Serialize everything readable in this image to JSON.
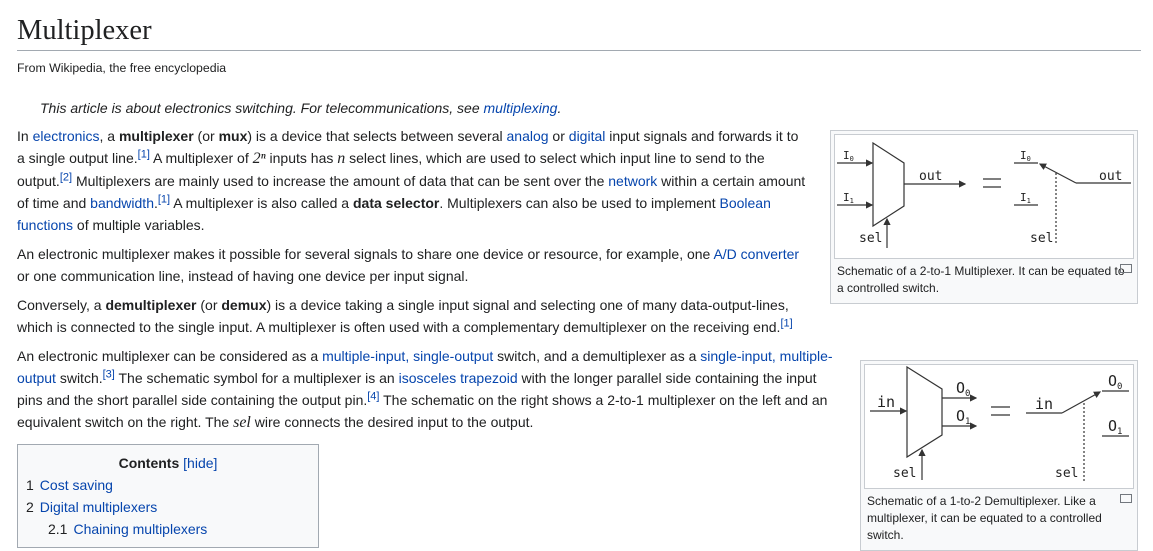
{
  "title": "Multiplexer",
  "tagline": "From Wikipedia, the free encyclopedia",
  "hatnote": {
    "text": "This article is about electronics switching. For telecommunications, see ",
    "link": "multiplexing",
    "end": "."
  },
  "paragraphs": [
    [
      [
        "t",
        "In "
      ],
      [
        "a",
        "electronics"
      ],
      [
        "t",
        ", a "
      ],
      [
        "b",
        "multiplexer"
      ],
      [
        "t",
        " (or "
      ],
      [
        "b",
        "mux"
      ],
      [
        "t",
        ") is a device that selects between several "
      ],
      [
        "a",
        "analog"
      ],
      [
        "t",
        " or "
      ],
      [
        "a",
        "digital"
      ],
      [
        "t",
        " input signals and forwards it to a single output line."
      ],
      [
        "sup",
        "[1]"
      ],
      [
        "t",
        " A multiplexer of "
      ],
      [
        "m",
        "2ⁿ"
      ],
      [
        "t",
        " inputs has "
      ],
      [
        "m",
        "n"
      ],
      [
        "t",
        " select lines, which are used to select which input line to send to the output."
      ],
      [
        "sup",
        "[2]"
      ],
      [
        "t",
        " Multiplexers are mainly used to increase the amount of data that can be sent over the "
      ],
      [
        "a",
        "network"
      ],
      [
        "t",
        " within a certain amount of time and "
      ],
      [
        "a",
        "bandwidth"
      ],
      [
        "t",
        "."
      ],
      [
        "sup",
        "[1]"
      ],
      [
        "t",
        " A multiplexer is also called a "
      ],
      [
        "b",
        "data selector"
      ],
      [
        "t",
        ". Multiplexers can also be used to implement "
      ],
      [
        "a",
        "Boolean functions"
      ],
      [
        "t",
        " of multiple variables."
      ]
    ],
    [
      [
        "t",
        "An electronic multiplexer makes it possible for several signals to share one device or resource, for example, one "
      ],
      [
        "a",
        "A/D converter"
      ],
      [
        "t",
        " or one communication line, instead of having one device per input signal."
      ]
    ],
    [
      [
        "t",
        "Conversely, a "
      ],
      [
        "b",
        "demultiplexer"
      ],
      [
        "t",
        " (or "
      ],
      [
        "b",
        "demux"
      ],
      [
        "t",
        ") is a device taking a single input signal and selecting one of many data-output-lines, which is connected to the single input. A multiplexer is often used with a complementary demultiplexer on the receiving end."
      ],
      [
        "sup",
        "[1]"
      ]
    ],
    [
      [
        "t",
        "An electronic multiplexer can be considered as a "
      ],
      [
        "a",
        "multiple-input, single-output"
      ],
      [
        "t",
        " switch, and a demultiplexer as a "
      ],
      [
        "a",
        "single-input, multiple-output"
      ],
      [
        "t",
        " switch."
      ],
      [
        "sup",
        "[3]"
      ],
      [
        "t",
        " The schematic symbol for a multiplexer is an "
      ],
      [
        "a",
        "isosceles trapezoid"
      ],
      [
        "t",
        " with the longer parallel side containing the input pins and the short parallel side containing the output pin."
      ],
      [
        "sup",
        "[4]"
      ],
      [
        "t",
        " The schematic on the right shows a 2-to-1 multiplexer on the left and an equivalent switch on the right. The "
      ],
      [
        "m",
        "sel"
      ],
      [
        "t",
        " wire connects the desired input to the output."
      ]
    ]
  ],
  "figures": [
    {
      "caption": "Schematic of a 2-to-1 Multiplexer. It can be equated to a controlled switch.",
      "labels": {
        "i0": "I",
        "i1": "I",
        "s0": "0",
        "s1": "1",
        "out": "out",
        "sel": "sel"
      }
    },
    {
      "caption": "Schematic of a 1-to-2 Demultiplexer. Like a multiplexer, it can be equated to a controlled switch.",
      "labels": {
        "in": "in",
        "o": "O",
        "s0": "0",
        "s1": "1",
        "sel": "sel"
      }
    }
  ],
  "toc": {
    "title": "Contents",
    "hide": "[hide]",
    "items": [
      {
        "num": "1",
        "label": "Cost saving"
      },
      {
        "num": "2",
        "label": "Digital multiplexers"
      },
      {
        "num": "2.1",
        "label": "Chaining multiplexers"
      }
    ]
  }
}
